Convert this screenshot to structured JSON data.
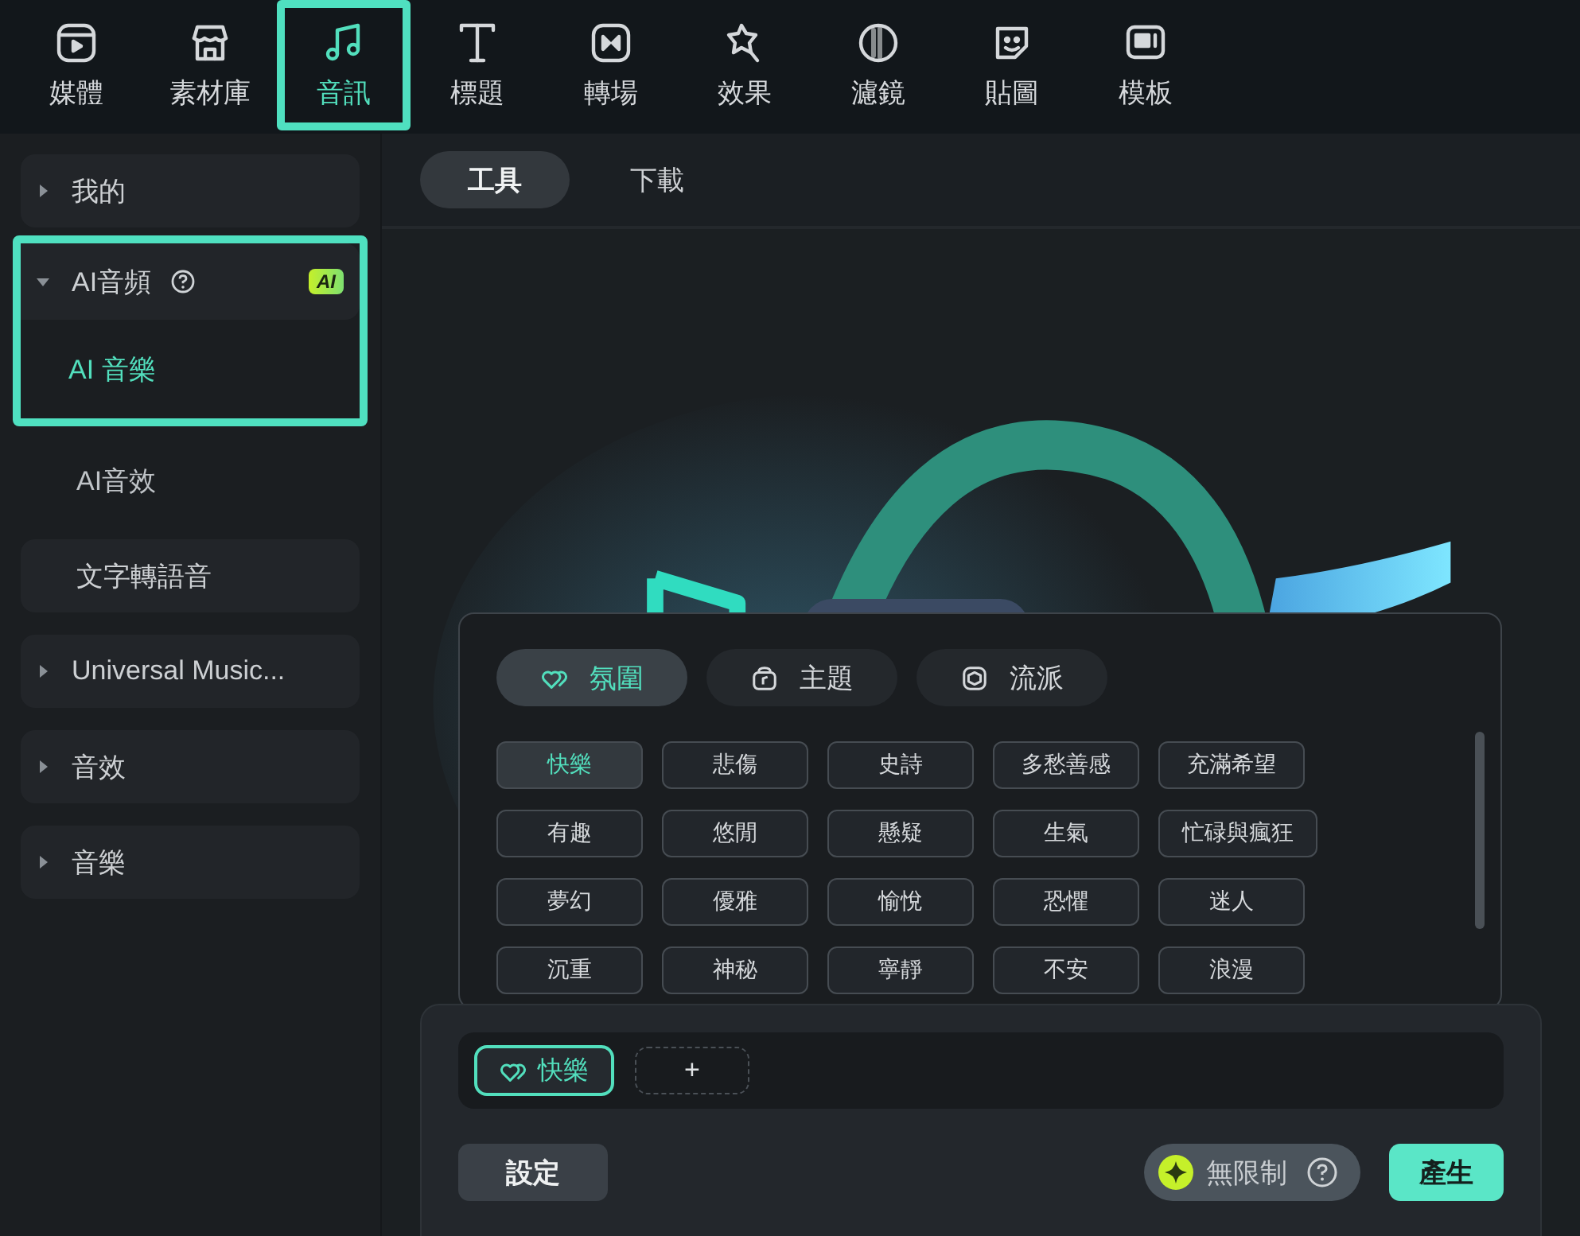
{
  "top_tabs": [
    {
      "label": "媒體",
      "selected": false,
      "highlighted": false
    },
    {
      "label": "素材庫",
      "selected": false,
      "highlighted": false
    },
    {
      "label": "音訊",
      "selected": true,
      "highlighted": true
    },
    {
      "label": "標題",
      "selected": false,
      "highlighted": false
    },
    {
      "label": "轉場",
      "selected": false,
      "highlighted": false
    },
    {
      "label": "效果",
      "selected": false,
      "highlighted": false
    },
    {
      "label": "濾鏡",
      "selected": false,
      "highlighted": false
    },
    {
      "label": "貼圖",
      "selected": false,
      "highlighted": false
    },
    {
      "label": "模板",
      "selected": false,
      "highlighted": false
    }
  ],
  "sidebar": {
    "items": [
      {
        "kind": "group",
        "label": "我的",
        "expanded": false
      },
      {
        "kind": "group",
        "label": "AI音頻",
        "expanded": true,
        "highlighted": true,
        "badge": "AI",
        "children": [
          {
            "label": "AI 音樂",
            "selected": true,
            "highlighted": true
          },
          {
            "label": "AI音效",
            "selected": false,
            "highlighted": false
          }
        ]
      },
      {
        "kind": "leaf",
        "label": "文字轉語音"
      },
      {
        "kind": "group",
        "label": "Universal Music...",
        "expanded": false
      },
      {
        "kind": "group",
        "label": "音效",
        "expanded": false
      },
      {
        "kind": "group",
        "label": "音樂",
        "expanded": false
      }
    ]
  },
  "sub_tabs": [
    {
      "label": "工具",
      "selected": true
    },
    {
      "label": "下載",
      "selected": false
    }
  ],
  "prompt_panel": {
    "categories": [
      {
        "label": "氛圍",
        "selected": true
      },
      {
        "label": "主題",
        "selected": false
      },
      {
        "label": "流派",
        "selected": false
      }
    ],
    "tag_rows": [
      [
        {
          "label": "快樂",
          "selected": true
        },
        {
          "label": "悲傷",
          "selected": false
        },
        {
          "label": "史詩",
          "selected": false
        },
        {
          "label": "多愁善感",
          "selected": false
        },
        {
          "label": "充滿希望",
          "selected": false
        }
      ],
      [
        {
          "label": "有趣",
          "selected": false
        },
        {
          "label": "悠閒",
          "selected": false
        },
        {
          "label": "懸疑",
          "selected": false
        },
        {
          "label": "生氣",
          "selected": false
        },
        {
          "label": "忙碌與瘋狂",
          "selected": false
        }
      ],
      [
        {
          "label": "夢幻",
          "selected": false
        },
        {
          "label": "優雅",
          "selected": false
        },
        {
          "label": "愉悅",
          "selected": false
        },
        {
          "label": "恐懼",
          "selected": false
        },
        {
          "label": "迷人",
          "selected": false
        }
      ],
      [
        {
          "label": "沉重",
          "selected": false
        },
        {
          "label": "神秘",
          "selected": false
        },
        {
          "label": "寧靜",
          "selected": false
        },
        {
          "label": "不安",
          "selected": false
        },
        {
          "label": "浪漫",
          "selected": false
        }
      ]
    ]
  },
  "selected_tags": [
    {
      "label": "快樂"
    }
  ],
  "add_tag_label": "+",
  "settings_button": "設定",
  "credits": {
    "label": "無限制"
  },
  "generate_button": "產生"
}
